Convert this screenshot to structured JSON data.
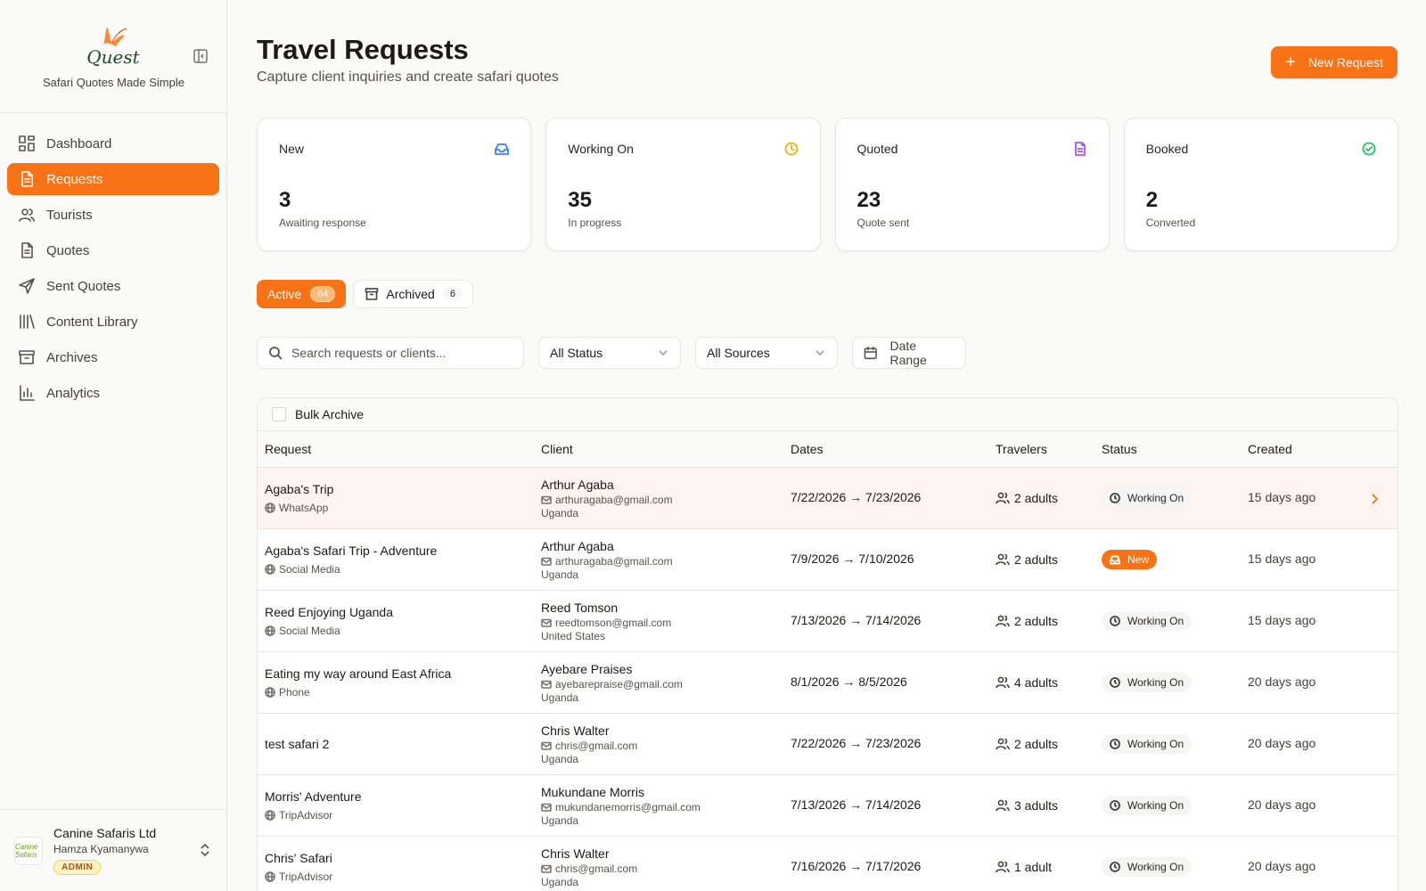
{
  "brand": {
    "logo_text": "Quest",
    "tagline": "Safari Quotes Made Simple",
    "colors": {
      "accent": "#f97316",
      "logo_green": "#1f4d2a"
    }
  },
  "sidebar": {
    "items": [
      {
        "label": "Dashboard",
        "icon": "dashboard-grid-icon",
        "active": false
      },
      {
        "label": "Requests",
        "icon": "document-icon",
        "active": true
      },
      {
        "label": "Tourists",
        "icon": "users-icon",
        "active": false
      },
      {
        "label": "Quotes",
        "icon": "file-text-icon",
        "active": false
      },
      {
        "label": "Sent Quotes",
        "icon": "send-icon",
        "active": false
      },
      {
        "label": "Content Library",
        "icon": "library-icon",
        "active": false
      },
      {
        "label": "Archives",
        "icon": "archive-icon",
        "active": false
      },
      {
        "label": "Analytics",
        "icon": "bar-chart-icon",
        "active": false
      }
    ],
    "user": {
      "org": "Canine Safaris Ltd",
      "name": "Hamza Kyamanywa",
      "role": "ADMIN",
      "avatar_text": "Canine Safaris"
    }
  },
  "header": {
    "title": "Travel Requests",
    "subtitle": "Capture client inquiries and create safari quotes",
    "new_button": "New Request"
  },
  "stats": [
    {
      "label": "New",
      "value": "3",
      "note": "Awaiting response",
      "icon": "inbox-icon",
      "color": "#3b82f6"
    },
    {
      "label": "Working On",
      "value": "35",
      "note": "In progress",
      "icon": "clock-icon",
      "color": "#eab308"
    },
    {
      "label": "Quoted",
      "value": "23",
      "note": "Quote sent",
      "icon": "file-text-icon",
      "color": "#a855f7"
    },
    {
      "label": "Booked",
      "value": "2",
      "note": "Converted",
      "icon": "check-circle-icon",
      "color": "#22c55e"
    }
  ],
  "tabs": {
    "active": {
      "label": "Active",
      "count": "64"
    },
    "archived": {
      "label": "Archived",
      "count": "6"
    }
  },
  "filters": {
    "search_placeholder": "Search requests or clients...",
    "status": "All Status",
    "sources": "All Sources",
    "date_range": "Date Range"
  },
  "table": {
    "bulk_label": "Bulk Archive",
    "headers": [
      "Request",
      "Client",
      "Dates",
      "Travelers",
      "Status",
      "Created"
    ],
    "rows": [
      {
        "title": "Agaba's Trip",
        "source": "WhatsApp",
        "client": "Arthur Agaba",
        "email": "arthuragaba@gmail.com",
        "country": "Uganda",
        "dates": "7/22/2026 → 7/23/2026",
        "travelers": "2 adults",
        "status": "Working On",
        "created": "15 days ago"
      },
      {
        "title": "Agaba's Safari Trip - Adventure",
        "source": "Social Media",
        "client": "Arthur Agaba",
        "email": "arthuragaba@gmail.com",
        "country": "Uganda",
        "dates": "7/9/2026 → 7/10/2026",
        "travelers": "2 adults",
        "status": "New",
        "created": "15 days ago"
      },
      {
        "title": "Reed Enjoying Uganda",
        "source": "Social Media",
        "client": "Reed Tomson",
        "email": "reedtomson@gmail.com",
        "country": "United States",
        "dates": "7/13/2026 → 7/14/2026",
        "travelers": "2 adults",
        "status": "Working On",
        "created": "15 days ago"
      },
      {
        "title": "Eating my way around East Africa",
        "source": "Phone",
        "client": "Ayebare Praises",
        "email": "ayebarepraise@gmail.com",
        "country": "Uganda",
        "dates": "8/1/2026 → 8/5/2026",
        "travelers": "4 adults",
        "status": "Working On",
        "created": "20 days ago"
      },
      {
        "title": "test safari 2",
        "source": "",
        "client": "Chris Walter",
        "email": "chris@gmail.com",
        "country": "Uganda",
        "dates": "7/22/2026 → 7/23/2026",
        "travelers": "2 adults",
        "status": "Working On",
        "created": "20 days ago"
      },
      {
        "title": "Morris' Adventure",
        "source": "TripAdvisor",
        "client": "Mukundane Morris",
        "email": "mukundanemorris@gmail.com",
        "country": "Uganda",
        "dates": "7/13/2026 → 7/14/2026",
        "travelers": "3 adults",
        "status": "Working On",
        "created": "20 days ago"
      },
      {
        "title": "Chris' Safari",
        "source": "TripAdvisor",
        "client": "Chris Walter",
        "email": "chris@gmail.com",
        "country": "Uganda",
        "dates": "7/16/2026 → 7/17/2026",
        "travelers": "1 adult",
        "status": "Working On",
        "created": "20 days ago"
      }
    ]
  }
}
